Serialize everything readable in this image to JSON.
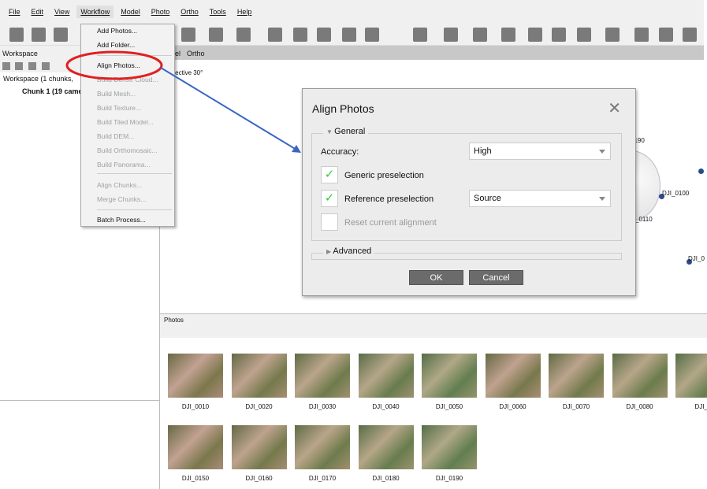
{
  "menubar": [
    "File",
    "Edit",
    "View",
    "Workflow",
    "Model",
    "Photo",
    "Ortho",
    "Tools",
    "Help"
  ],
  "workspace": {
    "title": "Workspace",
    "root": "Workspace (1 chunks,",
    "chunk": "Chunk 1 (19 came"
  },
  "tabs": {
    "model": "del",
    "ortho": "Ortho"
  },
  "viewport": {
    "projection": "rspective 30°",
    "labels": [
      "0190",
      "DJI_0100",
      "_0110",
      "DJI_0"
    ]
  },
  "workflow_menu": {
    "items": [
      {
        "label": "Add Photos...",
        "enabled": true
      },
      {
        "label": "Add Folder...",
        "enabled": true
      },
      {
        "label": "Align Photos...",
        "enabled": true
      },
      {
        "label": "Build Dense Cloud...",
        "enabled": false
      },
      {
        "label": "Build Mesh...",
        "enabled": false
      },
      {
        "label": "Build Texture...",
        "enabled": false
      },
      {
        "label": "Build Tiled Model...",
        "enabled": false
      },
      {
        "label": "Build DEM...",
        "enabled": false
      },
      {
        "label": "Build Orthomosaic...",
        "enabled": false
      },
      {
        "label": "Build Panorama...",
        "enabled": false
      },
      {
        "label": "Align Chunks...",
        "enabled": false
      },
      {
        "label": "Merge Chunks...",
        "enabled": false
      },
      {
        "label": "Batch Process...",
        "enabled": true
      }
    ]
  },
  "dialog": {
    "title": "Align Photos",
    "general": "General",
    "accuracy_label": "Accuracy:",
    "accuracy_value": "High",
    "generic": "Generic preselection",
    "generic_checked": true,
    "reference": "Reference preselection",
    "reference_checked": true,
    "reference_value": "Source",
    "reset": "Reset current alignment",
    "reset_checked": false,
    "advanced": "Advanced",
    "ok": "OK",
    "cancel": "Cancel"
  },
  "photos": {
    "title": "Photos",
    "items": [
      "DJI_0010",
      "DJI_0020",
      "DJI_0030",
      "DJI_0040",
      "DJI_0050",
      "DJI_0060",
      "DJI_0070",
      "DJI_0080",
      "DJI_0",
      "DJI_0150",
      "DJI_0160",
      "DJI_0170",
      "DJI_0180",
      "DJI_0190"
    ]
  },
  "colors": {
    "highlight_circle": "#e02020",
    "arrow": "#3a66c4",
    "check": "#2ecc40"
  }
}
